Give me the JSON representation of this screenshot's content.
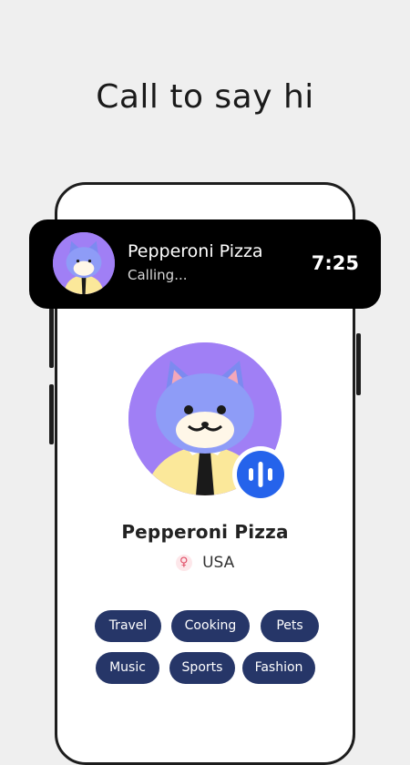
{
  "headline": "Call to say hi",
  "call_bar": {
    "name": "Pepperoni Pizza",
    "status": "Calling...",
    "timer": "7:25"
  },
  "profile": {
    "name": "Pepperoni Pizza",
    "country": "USA",
    "gender_symbol": "♀"
  },
  "tags": [
    "Travel",
    "Cooking",
    "Pets",
    "Music",
    "Sports",
    "Fashion"
  ],
  "colors": {
    "avatar_bg": "#a07ff5",
    "tag_bg": "#263668",
    "voice_badge": "#2563eb",
    "call_bar_bg": "#000000"
  },
  "icons": {
    "avatar": "cat-avatar-icon",
    "voice": "voice-wave-icon",
    "gender": "female-icon"
  }
}
